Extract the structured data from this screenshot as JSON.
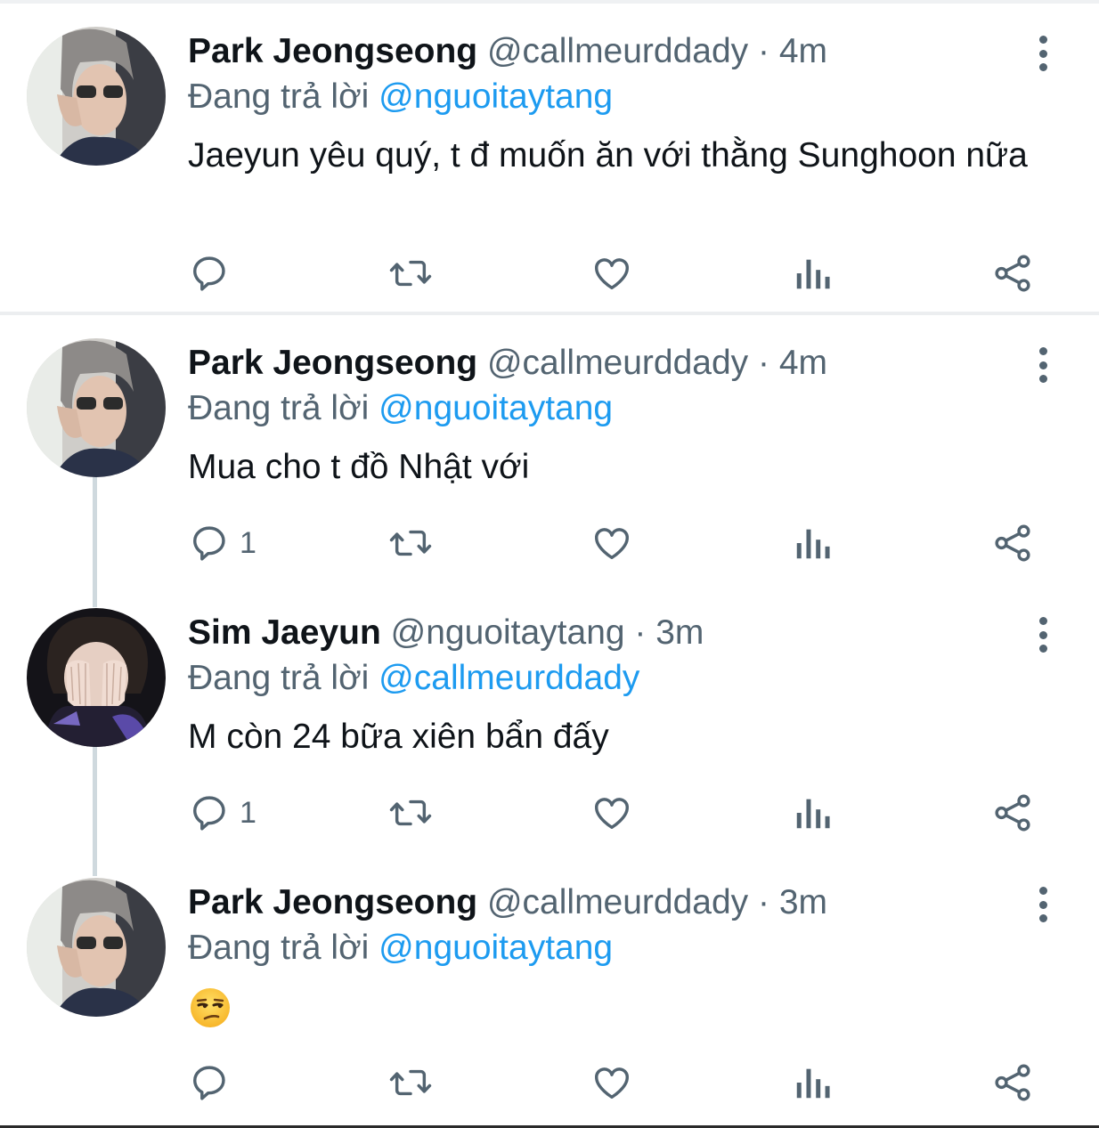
{
  "tweets": [
    {
      "name": "Park Jeongseong",
      "handle": "@callmeurddady",
      "time": "· 4m",
      "reply_prefix": "Đang trả lời",
      "reply_to": "@nguoitaytang",
      "text": "Jaeyun yêu quý, t đ muốn ăn với thằng Sunghoon nữa",
      "reply_count": ""
    },
    {
      "name": "Park Jeongseong",
      "handle": "@callmeurddady",
      "time": "· 4m",
      "reply_prefix": "Đang trả lời",
      "reply_to": "@nguoitaytang",
      "text": "Mua cho t đồ Nhật với",
      "reply_count": "1"
    },
    {
      "name": "Sim Jaeyun",
      "handle": "@nguoitaytang",
      "time": "· 3m",
      "reply_prefix": "Đang trả lời",
      "reply_to": "@callmeurddady",
      "text": "M còn 24 bữa xiên bẩn đấy",
      "reply_count": "1"
    },
    {
      "name": "Park Jeongseong",
      "handle": "@callmeurddady",
      "time": "· 3m",
      "reply_prefix": "Đang trả lời",
      "reply_to": "@nguoitaytang",
      "text": "😒",
      "reply_count": ""
    }
  ],
  "icons": {
    "reply": "reply-bubble-icon",
    "retweet": "retweet-icon",
    "like": "heart-icon",
    "views": "analytics-bars-icon",
    "share": "share-icon",
    "more": "more-vertical-icon"
  },
  "colors": {
    "name": "#0f1419",
    "secondary": "#536471",
    "mention": "#1d9bf0",
    "thread_line": "#cfd9de"
  }
}
